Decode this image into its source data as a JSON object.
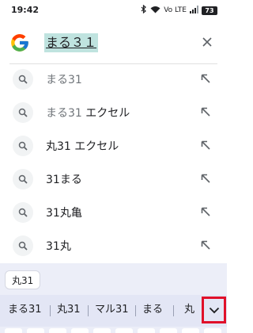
{
  "status_bar": {
    "time": "19:42",
    "network_label": "Vo LTE",
    "battery": "73"
  },
  "search": {
    "query": "まる３１",
    "logo_letter": "G"
  },
  "suggestions": [
    {
      "prefix": "まる31",
      "rest": ""
    },
    {
      "prefix": "まる31",
      "rest": " エクセル"
    },
    {
      "prefix": "",
      "rest": "丸31 エクセル"
    },
    {
      "prefix": "",
      "rest": "31まる"
    },
    {
      "prefix": "",
      "rest": "31丸亀"
    },
    {
      "prefix": "",
      "rest": "31丸"
    }
  ],
  "keyboard": {
    "clipboard_chip": "丸31",
    "candidates": [
      "まる31",
      "丸31",
      "マル31",
      "まる",
      "丸"
    ]
  },
  "colors": {
    "query_highlight": "#bfe3df",
    "expand_highlight": "#e0102a"
  }
}
